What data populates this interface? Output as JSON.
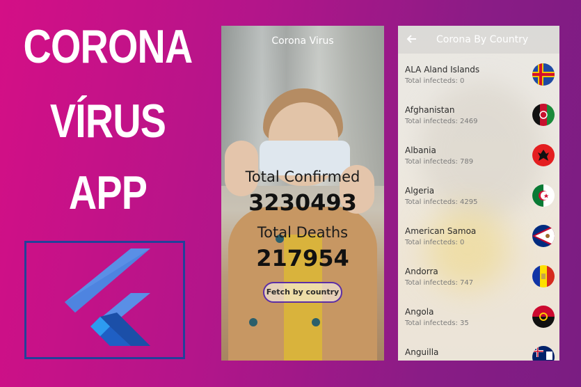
{
  "promo": {
    "line1": "CORONA",
    "line2": "VÍRUS",
    "line3": "APP"
  },
  "logo": {
    "icon": "flutter-logo"
  },
  "screen1": {
    "title": "Corona Virus",
    "confirmed_label": "Total Confirmed",
    "confirmed_value": "3230493",
    "deaths_label": "Total Deaths",
    "deaths_value": "217954",
    "fetch_button": "Fetch by country",
    "accent_color": "#5b2ea6"
  },
  "screen2": {
    "title": "Corona By Country",
    "back_icon": "arrow-left-icon",
    "countries": [
      {
        "name": "ALA Aland Islands",
        "sub": "Total infecteds: 0",
        "flag": "aland-flag-icon"
      },
      {
        "name": "Afghanistan",
        "sub": "Total infecteds: 2469",
        "flag": "afghanistan-flag-icon"
      },
      {
        "name": "Albania",
        "sub": "Total infecteds: 789",
        "flag": "albania-flag-icon"
      },
      {
        "name": "Algeria",
        "sub": "Total infecteds: 4295",
        "flag": "algeria-flag-icon"
      },
      {
        "name": "American Samoa",
        "sub": "Total infecteds: 0",
        "flag": "american-samoa-flag-icon"
      },
      {
        "name": "Andorra",
        "sub": "Total infecteds: 747",
        "flag": "andorra-flag-icon"
      },
      {
        "name": "Angola",
        "sub": "Total infecteds: 35",
        "flag": "angola-flag-icon"
      },
      {
        "name": "Anguilla",
        "sub": "",
        "flag": "anguilla-flag-icon"
      }
    ]
  }
}
